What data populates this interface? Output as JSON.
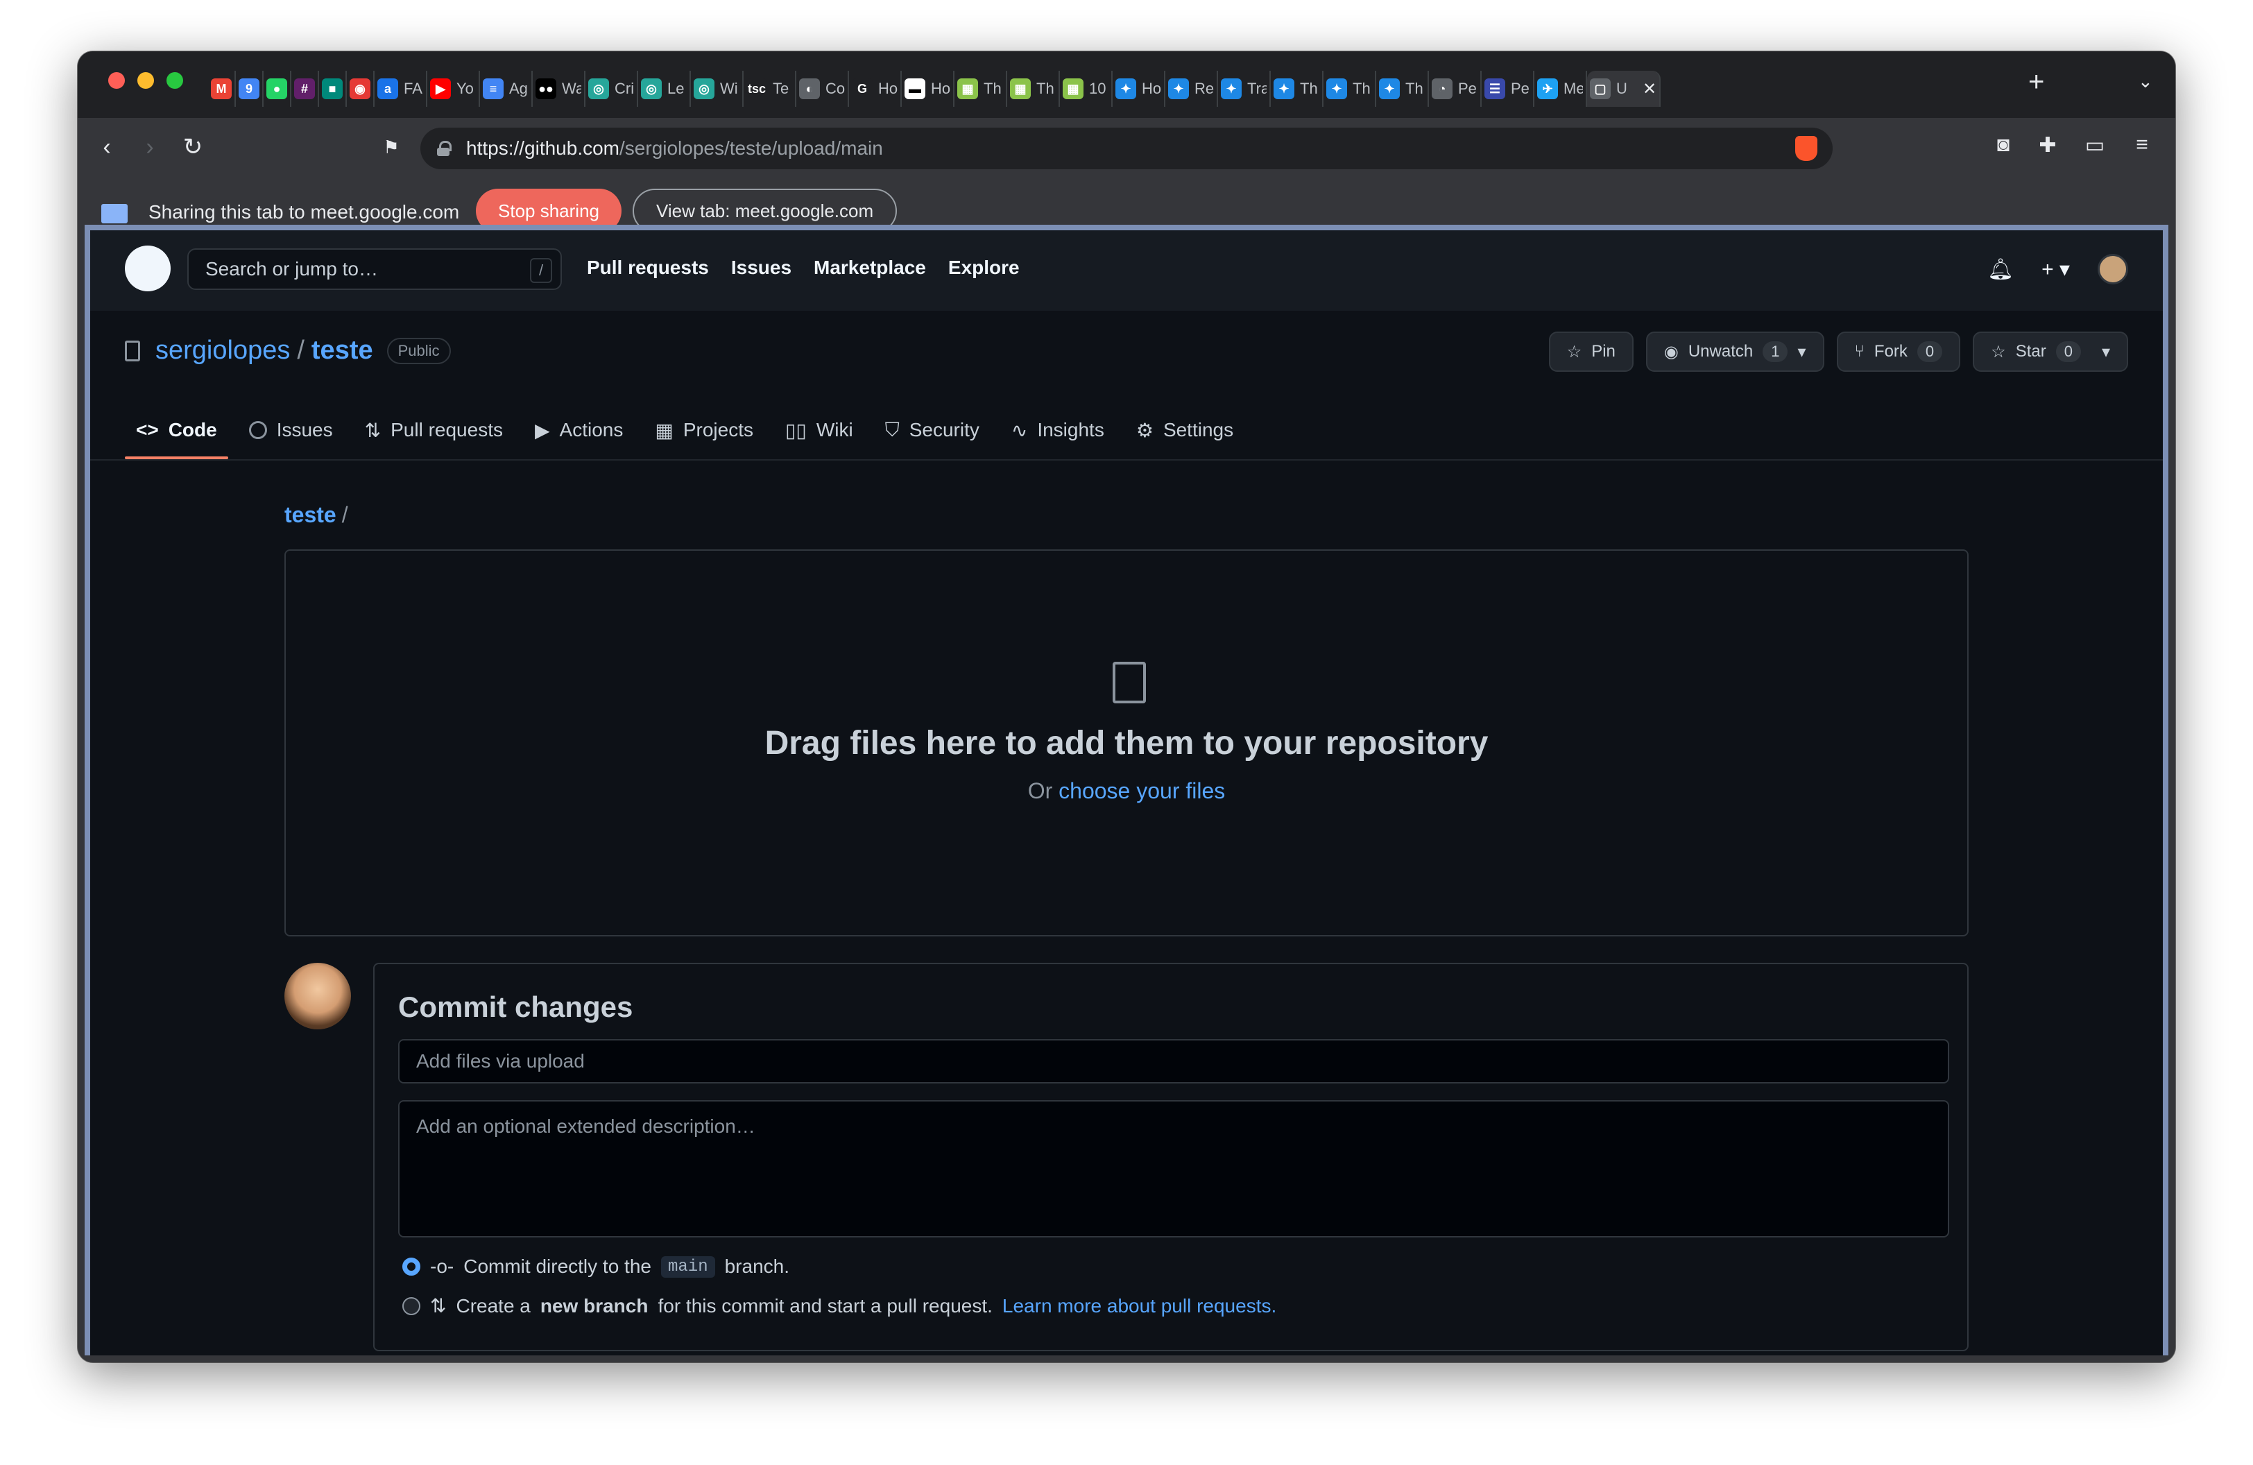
{
  "browser": {
    "tabs": [
      {
        "label": "M",
        "color": "#ea4335",
        "title": ""
      },
      {
        "label": "9",
        "color": "#4285f4",
        "title": ""
      },
      {
        "label": "●",
        "color": "#25d366",
        "title": ""
      },
      {
        "label": "#",
        "color": "#611f69",
        "title": ""
      },
      {
        "label": "■",
        "color": "#00897b",
        "title": ""
      },
      {
        "label": "◉",
        "color": "#e53935",
        "title": ""
      },
      {
        "label": "a",
        "color": "#1a73e8",
        "title": "FA"
      },
      {
        "label": "▶",
        "color": "#ff0000",
        "title": "Yo"
      },
      {
        "label": "≡",
        "color": "#4285f4",
        "title": "Ag"
      },
      {
        "label": "●●",
        "color": "#000000",
        "title": "Wa"
      },
      {
        "label": "◎",
        "color": "#26a69a",
        "title": "Cri"
      },
      {
        "label": "◎",
        "color": "#26a69a",
        "title": "Le"
      },
      {
        "label": "◎",
        "color": "#26a69a",
        "title": "Wi"
      },
      {
        "label": "tsc",
        "color": "#202124",
        "title": "Te"
      },
      {
        "label": "◐",
        "color": "#5f6368",
        "title": "Co"
      },
      {
        "label": "G",
        "color": "#202124",
        "title": "Ho"
      },
      {
        "label": "▬",
        "color": "#ffffff",
        "title": "Ho"
      },
      {
        "label": "▦",
        "color": "#8bc34a",
        "title": "Th"
      },
      {
        "label": "▦",
        "color": "#8bc34a",
        "title": "Th"
      },
      {
        "label": "▦",
        "color": "#8bc34a",
        "title": "10"
      },
      {
        "label": "✦",
        "color": "#1e88e5",
        "title": "Ho"
      },
      {
        "label": "✦",
        "color": "#1e88e5",
        "title": "Re"
      },
      {
        "label": "✦",
        "color": "#1e88e5",
        "title": "Tra"
      },
      {
        "label": "✦",
        "color": "#1e88e5",
        "title": "Th"
      },
      {
        "label": "✦",
        "color": "#1e88e5",
        "title": "Th"
      },
      {
        "label": "✦",
        "color": "#1e88e5",
        "title": "Th"
      },
      {
        "label": "◔",
        "color": "#5f6368",
        "title": "Pe"
      },
      {
        "label": "☰",
        "color": "#3949ab",
        "title": "Pe"
      },
      {
        "label": "✈",
        "color": "#1da1f2",
        "title": "Me"
      },
      {
        "label": "▢",
        "color": "#5f6368",
        "title": "U"
      }
    ],
    "new_tab": "+",
    "tab_menu": "⌄",
    "url_host": "https://github.com",
    "url_path": "/sergiolopes/teste/upload/main"
  },
  "sharebar": {
    "text": "Sharing this tab to meet.google.com",
    "stop": "Stop sharing",
    "view": "View tab: meet.google.com"
  },
  "gh": {
    "search_placeholder": "Search or jump to…",
    "slash": "/",
    "nav": [
      "Pull requests",
      "Issues",
      "Marketplace",
      "Explore"
    ],
    "owner": "sergiolopes",
    "repo": "teste",
    "visibility": "Public",
    "pin": "Pin",
    "unwatch": "Unwatch",
    "unwatch_count": "1",
    "fork": "Fork",
    "fork_count": "0",
    "star": "Star",
    "star_count": "0",
    "tabs": [
      "Code",
      "Issues",
      "Pull requests",
      "Actions",
      "Projects",
      "Wiki",
      "Security",
      "Insights",
      "Settings"
    ],
    "breadcrumb_repo": "teste",
    "breadcrumb_sep": "/",
    "drop_title": "Drag files here to add them to your repository",
    "drop_or": "Or",
    "drop_link": "choose your files",
    "commit_title": "Commit changes",
    "commit_placeholder": "Add files via upload",
    "desc_placeholder": "Add an optional extended description…",
    "opt1_pre": "Commit directly to the",
    "opt1_branch": "main",
    "opt1_post": "branch.",
    "opt2_pre": "Create a",
    "opt2_bold": "new branch",
    "opt2_mid": "for this commit and start a pull request.",
    "opt2_link": "Learn more about pull requests."
  }
}
